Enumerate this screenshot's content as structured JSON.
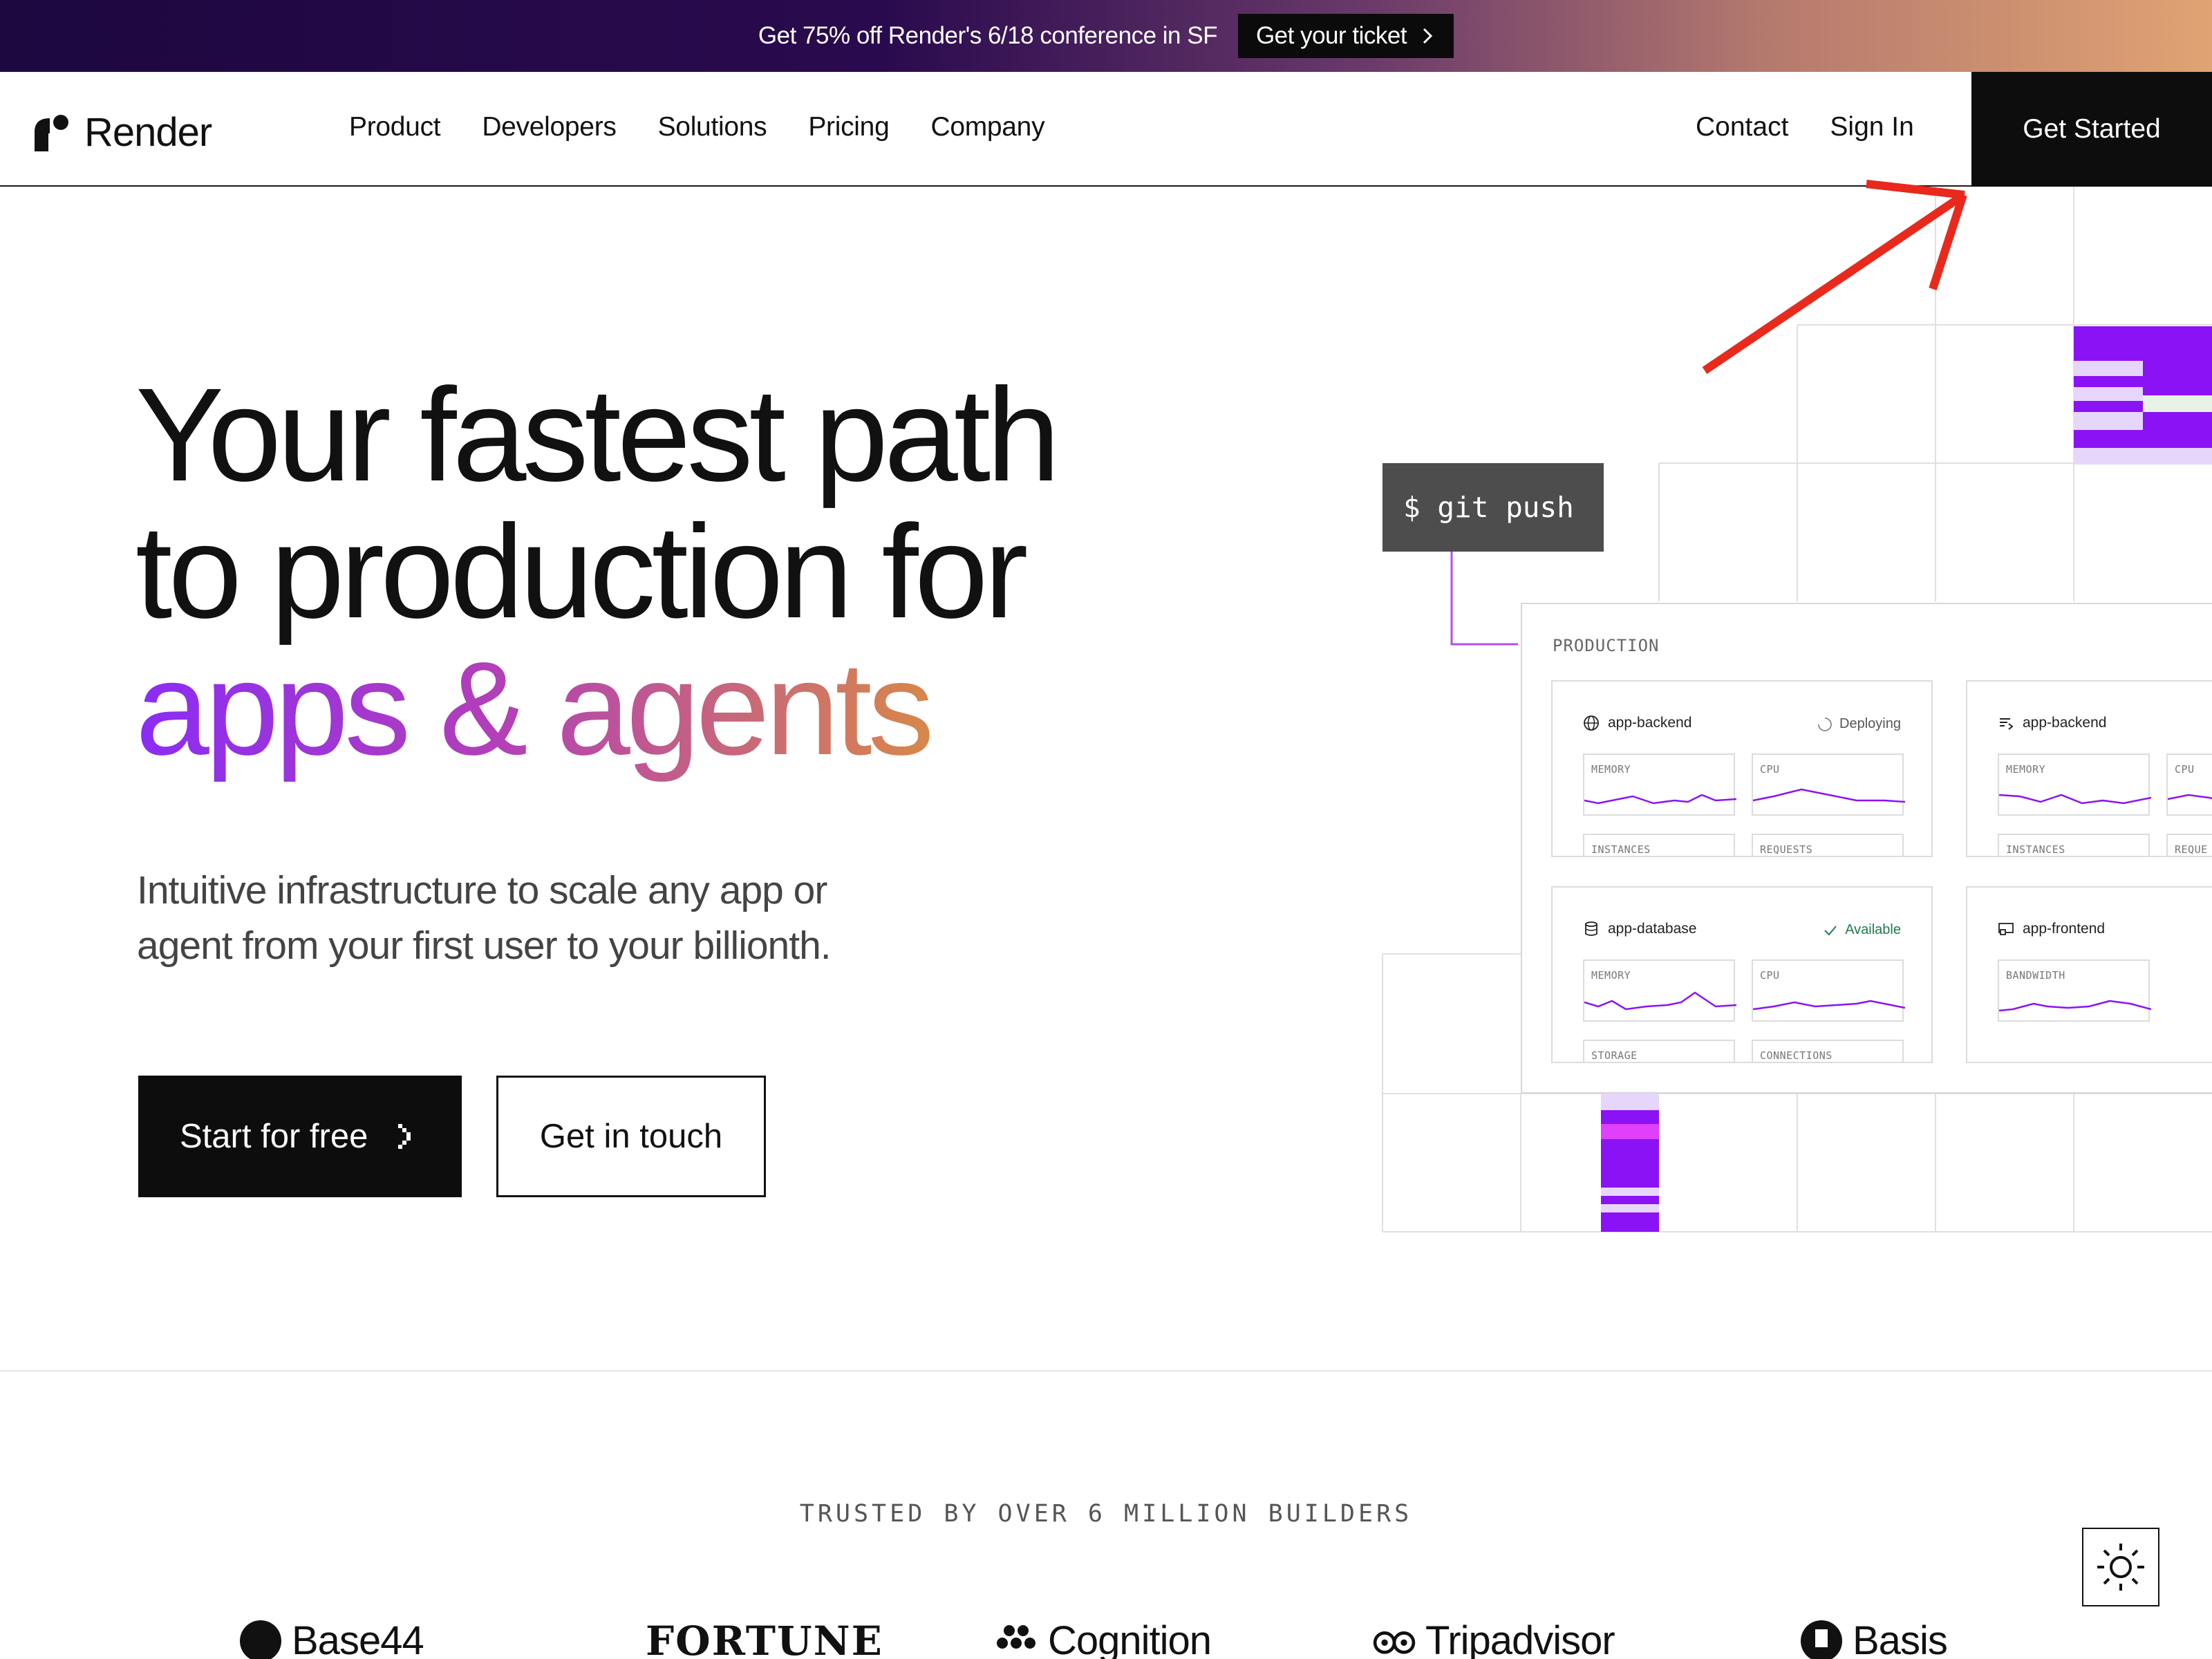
{
  "banner": {
    "text": "Get 75% off Render's 6/18 conference in SF",
    "button_label": "Get your ticket",
    "icon": "chevron-right-icon"
  },
  "header": {
    "logo_text": "Render",
    "nav": [
      "Product",
      "Developers",
      "Solutions",
      "Pricing",
      "Company"
    ],
    "contact": "Contact",
    "sign_in": "Sign In",
    "get_started": "Get Started"
  },
  "hero": {
    "title_line1": "Your fastest path",
    "title_line2": "to production for",
    "title_line3": "apps & agents",
    "subtitle": "Intuitive infrastructure to scale any app or agent from your first user to your billionth.",
    "primary_cta": "Start for free",
    "secondary_cta": "Get in touch"
  },
  "illustration": {
    "command": "$ git push",
    "panel_label": "PRODUCTION",
    "cards": [
      {
        "name": "app-backend",
        "status": "Deploying",
        "metrics": [
          "MEMORY",
          "CPU",
          "INSTANCES",
          "REQUESTS"
        ]
      },
      {
        "name": "app-backend",
        "status": "",
        "metrics": [
          "MEMORY",
          "CPU",
          "INSTANCES",
          "REQUE"
        ]
      },
      {
        "name": "app-database",
        "status": "Available",
        "metrics": [
          "MEMORY",
          "CPU",
          "STORAGE",
          "CONNECTIONS"
        ]
      },
      {
        "name": "app-frontend",
        "status": "",
        "metrics": [
          "BANDWIDTH"
        ]
      }
    ]
  },
  "trusted": {
    "heading": "TRUSTED BY OVER 6 MILLION BUILDERS",
    "logos": [
      "Base44",
      "FORTUNE",
      "Cognition",
      "Tripadvisor",
      "Basis"
    ]
  },
  "colors": {
    "accent_purple": "#8b12f5",
    "accent_pink": "#e040fb",
    "annotation_red": "#e8291c",
    "dark": "#0d0d0d"
  }
}
